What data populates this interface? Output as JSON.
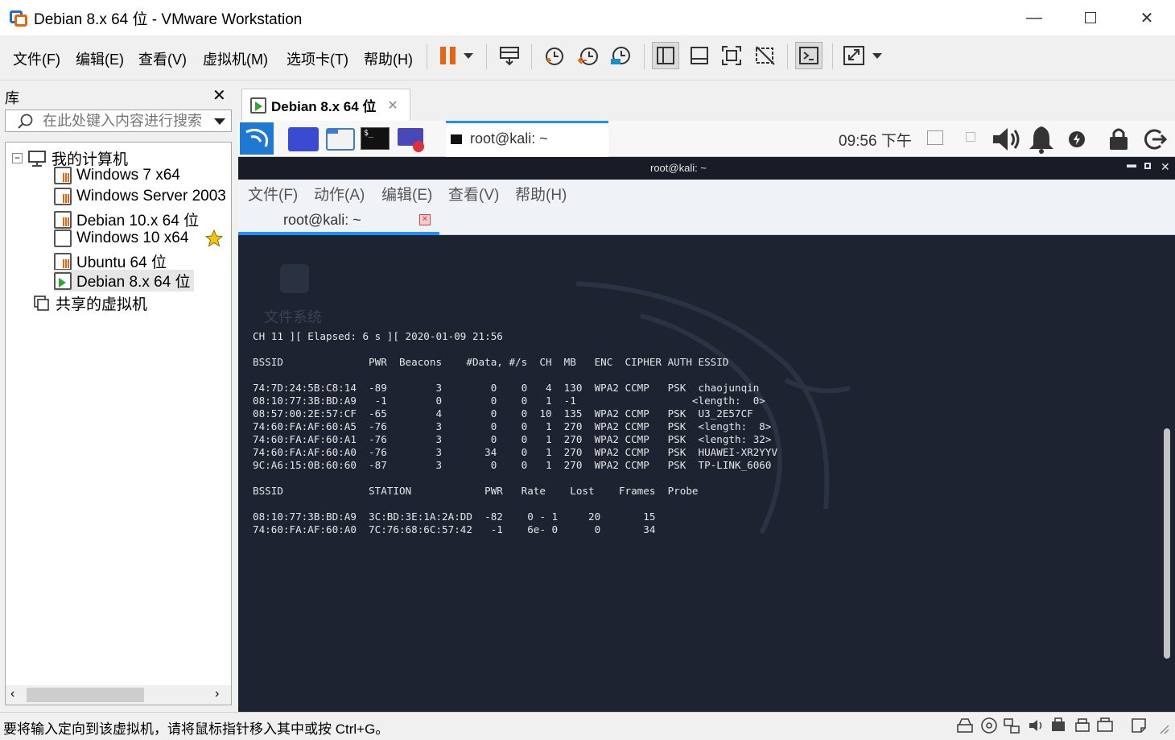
{
  "window": {
    "title": "Debian 8.x 64 位 - VMware Workstation"
  },
  "menu": {
    "file": "文件(F)",
    "edit": "编辑(E)",
    "view": "查看(V)",
    "vm": "虚拟机(M)",
    "tabs": "选项卡(T)",
    "help": "帮助(H)"
  },
  "toolbar": {
    "icons": [
      "pause-icon",
      "dropdown-icon",
      "send-ctrl-alt-del-icon",
      "snapshot-take-icon",
      "snapshot-revert-icon",
      "snapshot-manager-icon",
      "view-library-icon",
      "view-thumbnail-icon",
      "fullscreen-icon",
      "unity-icon",
      "console-view-icon",
      "stretch-icon"
    ]
  },
  "library": {
    "header": "库",
    "search_placeholder": "在此处键入内容进行搜索",
    "root": "我的计算机",
    "vms": [
      {
        "name": "Windows 7 x64",
        "state": "suspended"
      },
      {
        "name": "Windows Server 2003",
        "state": "suspended"
      },
      {
        "name": "Debian 10.x 64 位",
        "state": "suspended"
      },
      {
        "name": "Windows 10 x64",
        "state": "off",
        "favorite": true
      },
      {
        "name": "Ubuntu 64 位",
        "state": "suspended"
      },
      {
        "name": "Debian 8.x 64 位",
        "state": "running",
        "selected": true
      }
    ],
    "shared": "共享的虚拟机"
  },
  "vm_tab": {
    "label": "Debian 8.x 64 位"
  },
  "guest_panel": {
    "task": "root@kali: ~",
    "clock": "09:56 下午"
  },
  "terminal": {
    "window_title": "root@kali: ~",
    "menu": [
      "文件(F)",
      "动作(A)",
      "编辑(E)",
      "查看(V)",
      "帮助(H)"
    ],
    "tab_label": "root@kali: ~",
    "desktop_label": "文件系统",
    "lines": [
      "CH 11 ][ Elapsed: 6 s ][ 2020-01-09 21:56",
      "",
      "BSSID              PWR  Beacons    #Data, #/s  CH  MB   ENC  CIPHER AUTH ESSID",
      "",
      "74:7D:24:5B:C8:14  -89        3        0    0   4  130  WPA2 CCMP   PSK  chaojunqin",
      "08:10:77:3B:BD:A9   -1        0        0    0   1  -1                   <length:  0>",
      "08:57:00:2E:57:CF  -65        4        0    0  10  135  WPA2 CCMP   PSK  U3_2E57CF",
      "74:60:FA:AF:60:A5  -76        3        0    0   1  270  WPA2 CCMP   PSK  <length:  8>",
      "74:60:FA:AF:60:A1  -76        3        0    0   1  270  WPA2 CCMP   PSK  <length: 32>",
      "74:60:FA:AF:60:A0  -76        3       34    0   1  270  WPA2 CCMP   PSK  HUAWEI-XR2YYV",
      "9C:A6:15:0B:60:60  -87        3        0    0   1  270  WPA2 CCMP   PSK  TP-LINK_6060",
      "",
      "BSSID              STATION            PWR   Rate    Lost    Frames  Probe",
      "",
      "08:10:77:3B:BD:A9  3C:BD:3E:1A:2A:DD  -82    0 - 1     20       15",
      "74:60:FA:AF:60:A0  7C:76:68:6C:57:42   -1    6e- 0      0       34"
    ]
  },
  "statusbar": {
    "text": "要将输入定向到该虚拟机，请将鼠标指针移入其中或按 Ctrl+G。"
  },
  "colors": {
    "accent": "#1e90ff",
    "terminal_bg": "#1d2331",
    "pause_orange": "#e5660f"
  }
}
